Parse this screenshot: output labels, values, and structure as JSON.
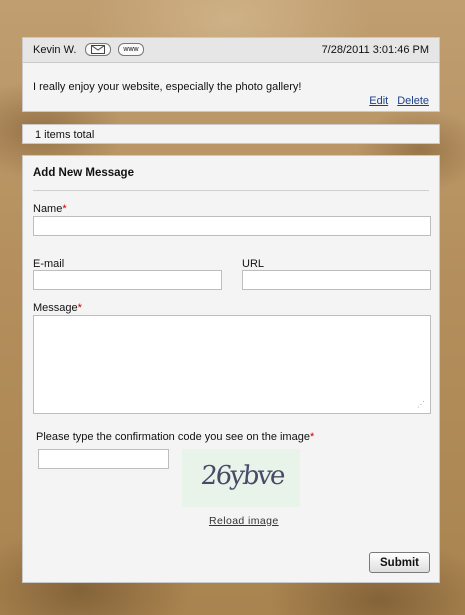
{
  "comment": {
    "author": "Kevin W.",
    "email_icon": "envelope-icon",
    "www_label": "www",
    "datetime": "7/28/2011 3:01:46 PM",
    "text": "I really enjoy your website, especially the photo gallery!",
    "edit_label": "Edit",
    "delete_label": "Delete"
  },
  "summary": {
    "total_text": "1 items total"
  },
  "form": {
    "title": "Add New Message",
    "name_label": "Name",
    "email_label": "E-mail",
    "url_label": "URL",
    "message_label": "Message",
    "required_mark": "*",
    "name_value": "",
    "email_value": "",
    "url_value": "",
    "message_value": "",
    "captcha_prompt": "Please type the confirmation code you see on the image",
    "captcha_value": "",
    "captcha_image_text": "26ybve",
    "reload_label": "Reload image",
    "submit_label": "Submit"
  },
  "colors": {
    "required": "#c00000",
    "link": "#1b3f8b",
    "panel": "#f4f4f4"
  }
}
